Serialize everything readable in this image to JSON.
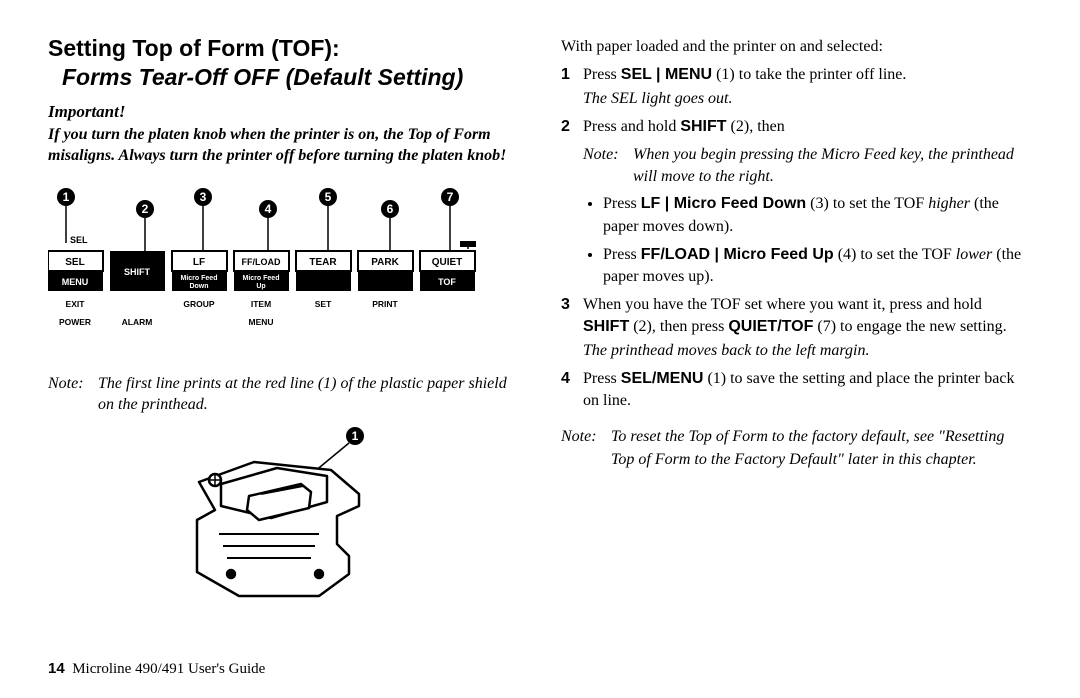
{
  "heading": {
    "main": "Setting Top of Form (TOF):",
    "sub": "Forms Tear-Off OFF (Default Setting)"
  },
  "important": {
    "label": "Important!",
    "body": "If you turn the platen knob when the printer is on, the Top of Form misaligns. Always turn the printer off before turning the platen knob!"
  },
  "panel": {
    "callouts": [
      "1",
      "2",
      "3",
      "4",
      "5",
      "6",
      "7"
    ],
    "sel_light": "SEL",
    "buttons_top": [
      "SEL",
      "",
      "LF",
      "FF/LOAD",
      "TEAR",
      "PARK",
      "QUIET"
    ],
    "buttons_bot": [
      "MENU",
      "SHIFT",
      "Micro Feed Down",
      "Micro Feed Up",
      "",
      "",
      "TOF"
    ],
    "row2": [
      "EXIT",
      "",
      "GROUP",
      "ITEM",
      "SET",
      "PRINT",
      ""
    ],
    "row3": [
      "POWER",
      "ALARM",
      "",
      "MENU",
      "",
      "",
      ""
    ]
  },
  "note_left": {
    "label": "Note:",
    "text": "The first line prints at the red line (1) of the plastic paper shield on the printhead."
  },
  "printer_callout": "1",
  "right": {
    "lead": "With paper loaded and the printer on and selected:",
    "step1_a": "Press ",
    "step1_b": "SEL | MENU",
    "step1_c": " (1) to take the printer off line.",
    "step1_result": "The SEL light goes out.",
    "step2_a": "Press and hold ",
    "step2_b": "SHIFT",
    "step2_c": " (2), then",
    "step2_note_label": "Note:",
    "step2_note_text": "When you begin pressing the Micro Feed key, the printhead will move to the right.",
    "bullet1_a": "Press ",
    "bullet1_b": "LF | Micro Feed Down",
    "bullet1_c": " (3) to set the TOF ",
    "bullet1_d": "higher",
    "bullet1_e": " (the paper moves down).",
    "bullet2_a": "Press ",
    "bullet2_b": "FF/LOAD | Micro Feed Up",
    "bullet2_c": " (4) to set the TOF ",
    "bullet2_d": "lower",
    "bullet2_e": " (the paper moves up).",
    "step3_a": "When you have the TOF set where you want it, press and hold ",
    "step3_b": "SHIFT",
    "step3_c": " (2), then press ",
    "step3_d": "QUIET/TOF",
    "step3_e": " (7) to engage the new setting.",
    "step3_result": "The printhead moves back to the left margin.",
    "step4_a": "Press ",
    "step4_b": "SEL/MENU",
    "step4_c": " (1) to save the setting and place the printer back on line.",
    "final_note_label": "Note:",
    "final_note_text": "To reset the Top of Form to the factory default, see \"Resetting Top of Form to the Factory Default\" later in this chapter."
  },
  "footer": {
    "page": "14",
    "title": "Microline 490/491 User's Guide"
  }
}
